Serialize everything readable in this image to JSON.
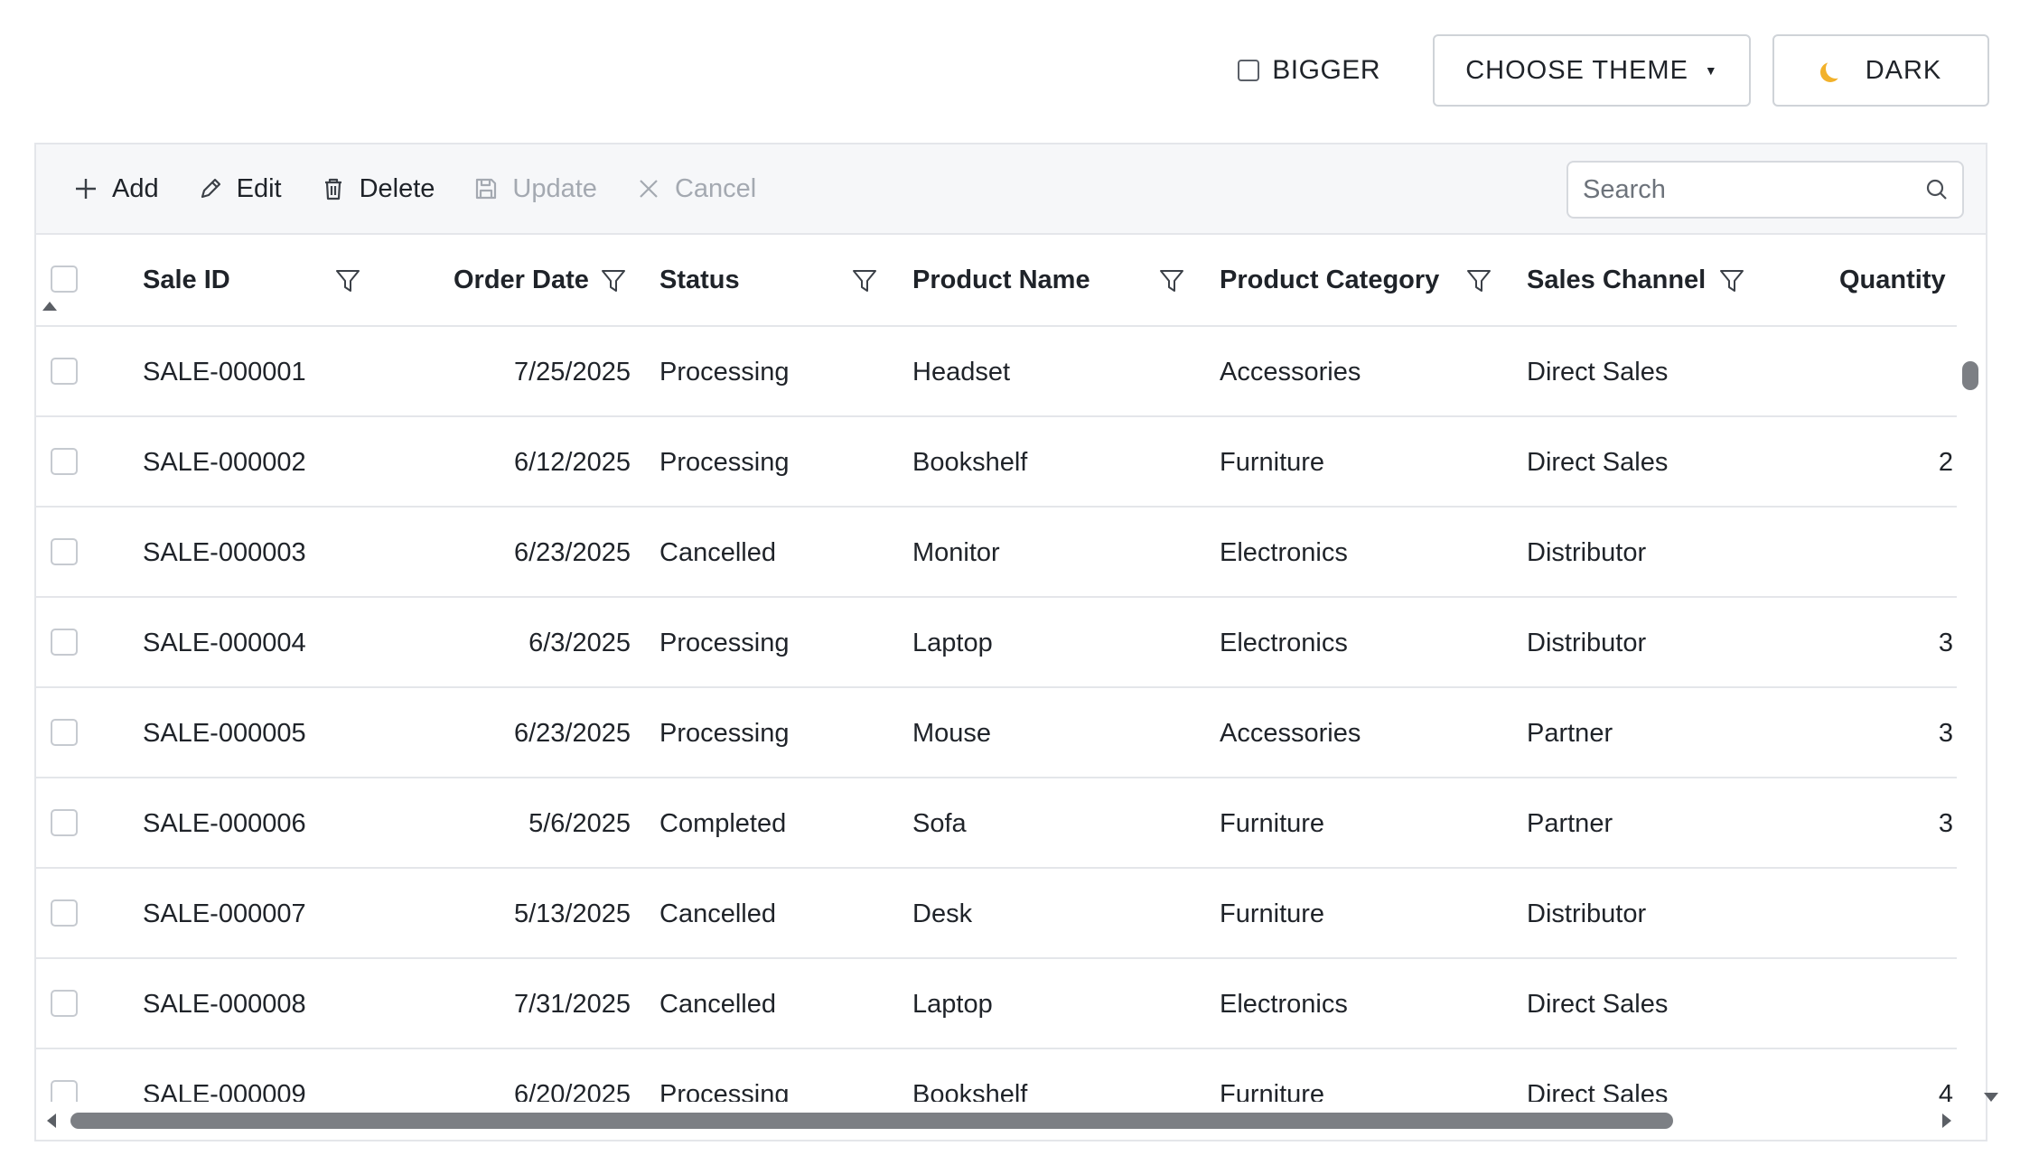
{
  "top_controls": {
    "bigger_label": "BIGGER",
    "theme_label": "CHOOSE THEME",
    "dark_label": "DARK"
  },
  "toolbar": {
    "add": "Add",
    "edit": "Edit",
    "delete": "Delete",
    "update": "Update",
    "cancel": "Cancel",
    "search_placeholder": "Search"
  },
  "columns": {
    "sale_id": "Sale ID",
    "order_date": "Order Date",
    "status": "Status",
    "product_name": "Product Name",
    "product_category": "Product Category",
    "sales_channel": "Sales Channel",
    "quantity": "Quantity"
  },
  "rows": [
    {
      "sale_id": "SALE-000001",
      "order_date": "7/25/2025",
      "status": "Processing",
      "product_name": "Headset",
      "product_category": "Accessories",
      "sales_channel": "Direct Sales",
      "quantity": ""
    },
    {
      "sale_id": "SALE-000002",
      "order_date": "6/12/2025",
      "status": "Processing",
      "product_name": "Bookshelf",
      "product_category": "Furniture",
      "sales_channel": "Direct Sales",
      "quantity": "2"
    },
    {
      "sale_id": "SALE-000003",
      "order_date": "6/23/2025",
      "status": "Cancelled",
      "product_name": "Monitor",
      "product_category": "Electronics",
      "sales_channel": "Distributor",
      "quantity": ""
    },
    {
      "sale_id": "SALE-000004",
      "order_date": "6/3/2025",
      "status": "Processing",
      "product_name": "Laptop",
      "product_category": "Electronics",
      "sales_channel": "Distributor",
      "quantity": "3"
    },
    {
      "sale_id": "SALE-000005",
      "order_date": "6/23/2025",
      "status": "Processing",
      "product_name": "Mouse",
      "product_category": "Accessories",
      "sales_channel": "Partner",
      "quantity": "3"
    },
    {
      "sale_id": "SALE-000006",
      "order_date": "5/6/2025",
      "status": "Completed",
      "product_name": "Sofa",
      "product_category": "Furniture",
      "sales_channel": "Partner",
      "quantity": "3"
    },
    {
      "sale_id": "SALE-000007",
      "order_date": "5/13/2025",
      "status": "Cancelled",
      "product_name": "Desk",
      "product_category": "Furniture",
      "sales_channel": "Distributor",
      "quantity": ""
    },
    {
      "sale_id": "SALE-000008",
      "order_date": "7/31/2025",
      "status": "Cancelled",
      "product_name": "Laptop",
      "product_category": "Electronics",
      "sales_channel": "Direct Sales",
      "quantity": ""
    },
    {
      "sale_id": "SALE-000009",
      "order_date": "6/20/2025",
      "status": "Processing",
      "product_name": "Bookshelf",
      "product_category": "Furniture",
      "sales_channel": "Direct Sales",
      "quantity": "4"
    }
  ]
}
